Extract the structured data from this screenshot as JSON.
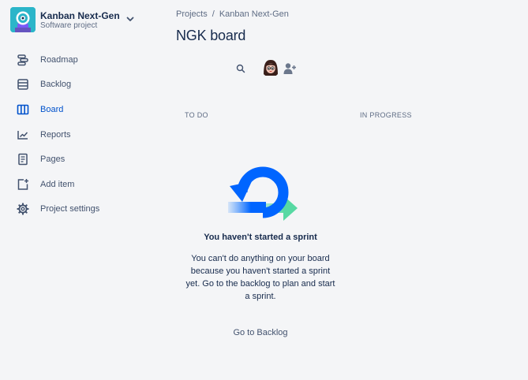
{
  "project": {
    "name": "Kanban Next-Gen",
    "type": "Software project",
    "avatar_icon": "robot-avatar-icon",
    "accent": "#2BB5C9"
  },
  "sidebar": {
    "items": [
      {
        "label": "Roadmap",
        "icon": "roadmap-icon",
        "active": false
      },
      {
        "label": "Backlog",
        "icon": "backlog-icon",
        "active": false
      },
      {
        "label": "Board",
        "icon": "board-icon",
        "active": true
      },
      {
        "label": "Reports",
        "icon": "reports-icon",
        "active": false
      },
      {
        "label": "Pages",
        "icon": "pages-icon",
        "active": false
      },
      {
        "label": "Add item",
        "icon": "add-item-icon",
        "active": false
      },
      {
        "label": "Project settings",
        "icon": "gear-icon",
        "active": false
      }
    ],
    "active_color": "#0052CC"
  },
  "header": {
    "breadcrumb": [
      "Projects",
      "Kanban Next-Gen"
    ],
    "breadcrumb_separator": "/",
    "title": "NGK board"
  },
  "board": {
    "columns": [
      "TO DO",
      "IN PROGRESS"
    ]
  },
  "empty_state": {
    "title": "You haven't started a sprint",
    "description": "You can't do anything on your board because you haven't started a sprint yet. Go to the backlog to plan and start a sprint.",
    "link_label": "Go to Backlog"
  },
  "colors": {
    "background": "#F4F5F7",
    "text_primary": "#172B4D",
    "text_secondary": "#5E6C84",
    "illustration_blue": "#0065FF",
    "illustration_green": "#57D9A3"
  }
}
